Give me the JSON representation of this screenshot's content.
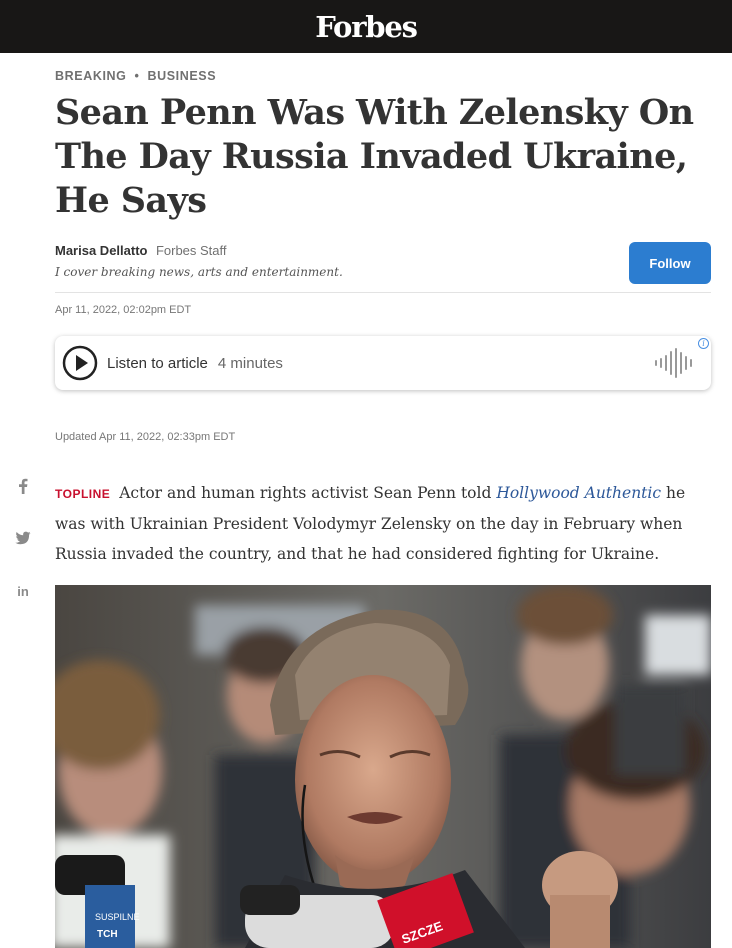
{
  "header": {
    "logo": "Forbes"
  },
  "breadcrumb": {
    "primary": "BREAKING",
    "separator": "•",
    "secondary": "BUSINESS"
  },
  "article": {
    "title": "Sean Penn Was With Zelensky On The Day Russia Invaded Ukraine, He Says",
    "author": {
      "name": "Marisa Dellatto",
      "role": "Forbes Staff",
      "bio": "I cover breaking news, arts and entertainment."
    },
    "follow_label": "Follow",
    "published": "Apr 11, 2022, 02:02pm EDT",
    "updated": "Updated Apr 11, 2022, 02:33pm EDT",
    "listen": {
      "label": "Listen to article",
      "duration": "4 minutes"
    },
    "topline": {
      "label": "TOPLINE",
      "before_link": "Actor and human rights activist Sean Penn told",
      "link": "Hollywood Authentic",
      "after_link": "he was with Ukrainian President Volodymyr Zelensky on the day in February when Russia invaded the country, and that he had considered fighting for Ukraine."
    }
  },
  "social": [
    {
      "icon": "facebook-icon",
      "glyph": "f"
    },
    {
      "icon": "twitter-icon",
      "glyph": "twitter"
    },
    {
      "icon": "linkedin-icon",
      "glyph": "in"
    }
  ],
  "photo": {
    "mic_text_1": "SUSPILNE",
    "mic_text_2": "ТСН",
    "mic_text_3": "SZCZE"
  },
  "colors": {
    "topbar": "#181716",
    "follow_button": "#2c7dd0",
    "topline_label": "#c8102e",
    "link": "#2d5899"
  }
}
